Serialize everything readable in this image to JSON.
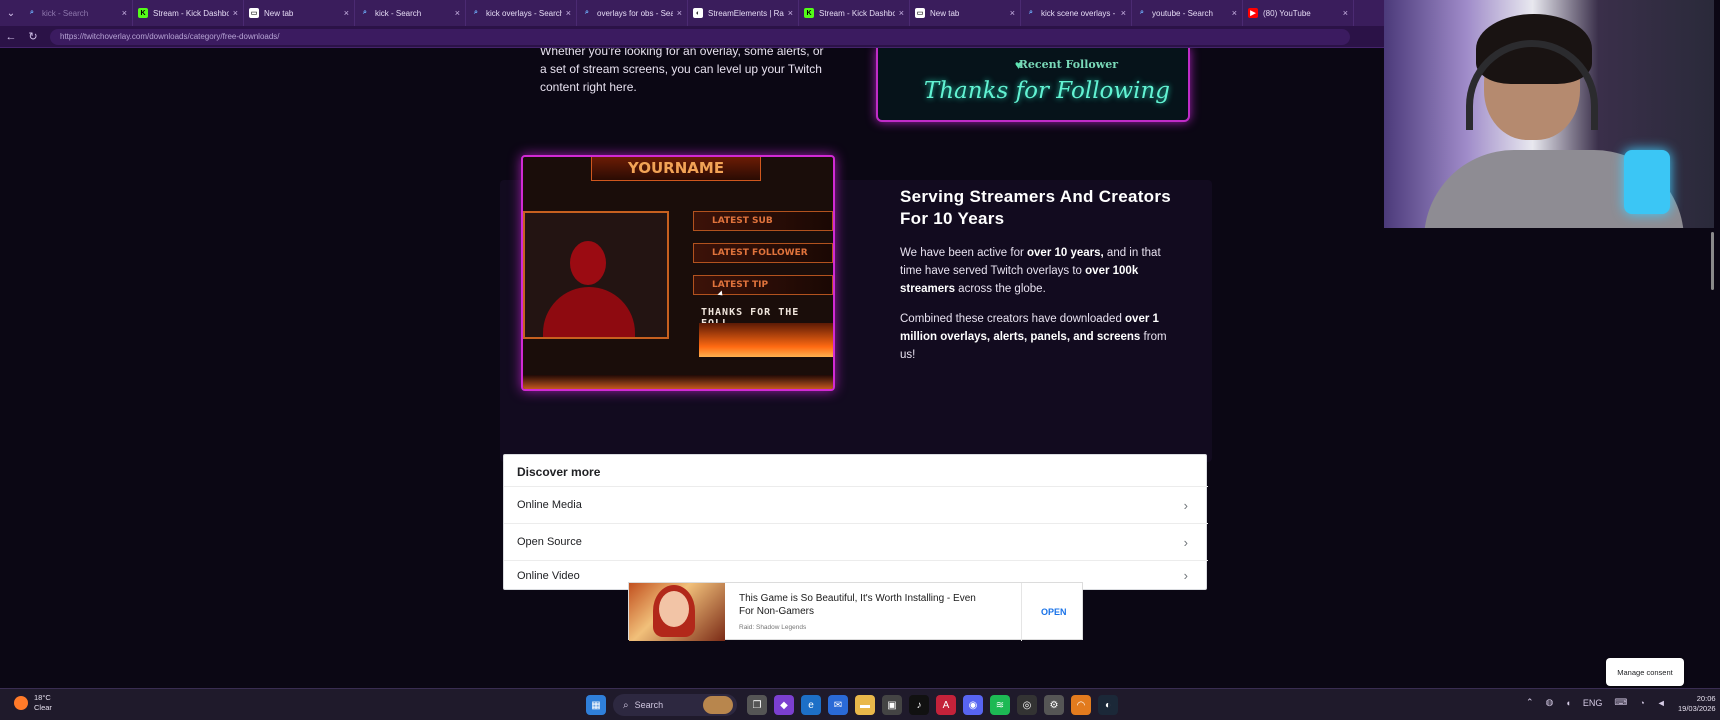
{
  "browser": {
    "tabs": [
      {
        "title": "kick - Search",
        "favicon": "search-icon",
        "dim": true
      },
      {
        "title": "Stream - Kick Dashboard",
        "favicon": "kick-icon"
      },
      {
        "title": "New tab",
        "favicon": "newtab-icon"
      },
      {
        "title": "kick - Search",
        "favicon": "search-icon"
      },
      {
        "title": "kick overlays - Search",
        "favicon": "search-icon"
      },
      {
        "title": "overlays for obs - Search",
        "favicon": "search-icon"
      },
      {
        "title": "StreamElements | Razor",
        "favicon": "streamelements-icon"
      },
      {
        "title": "Stream - Kick Dashboard",
        "favicon": "kick-icon"
      },
      {
        "title": "New tab",
        "favicon": "newtab-icon"
      },
      {
        "title": "kick scene overlays - Search",
        "favicon": "search-icon"
      },
      {
        "title": "youtube - Search",
        "favicon": "search-icon"
      },
      {
        "title": "(80) YouTube",
        "favicon": "youtube-icon"
      }
    ],
    "url": "https://twitchoverlay.com/downloads/category/free-downloads/"
  },
  "page": {
    "intro_text": "Whether you're looking for an overlay, some alerts, or a set of stream screens, you can level up your Twitch content right here.",
    "thanks_card": {
      "recent_label": "Recent Follower",
      "thanks_text": "Thanks for Following"
    },
    "overlay_preview": {
      "name": "YOURNAME",
      "bars": [
        "LATEST SUB",
        "LATEST FOLLOWER",
        "LATEST TIP"
      ],
      "thanks": "THANKS FOR THE FOLL"
    },
    "feature": {
      "title": "Serving Streamers And Creators For 10 Years",
      "p1": {
        "t1": "We have been active for ",
        "b1": "over 10 years,",
        "t2": " and in that time have served Twitch overlays to ",
        "b2": "over 100k streamers",
        "t3": " across the globe."
      },
      "p2": {
        "t1": "Combined these creators have downloaded ",
        "b1": "over 1 million overlays, alerts, panels, and screens",
        "t2": " from us!"
      }
    },
    "discover": {
      "title": "Discover more",
      "items": [
        "Online Media",
        "Open Source",
        "Online Video"
      ]
    },
    "ad": {
      "title": "This Game is So Beautiful, It's Worth Installing - Even For Non-Gamers",
      "source": "Raid: Shadow Legends",
      "open_label": "OPEN"
    },
    "consent_label": "Manage consent"
  },
  "taskbar": {
    "weather_temp": "18°C",
    "weather_desc": "Clear",
    "search_label": "Search",
    "lang": "ENG",
    "time": "20:06",
    "date": "19/03/2026"
  },
  "colors": {
    "accent": "#d12ad4",
    "background": "#0b0714",
    "tab_bar": "#3a1d5c"
  }
}
